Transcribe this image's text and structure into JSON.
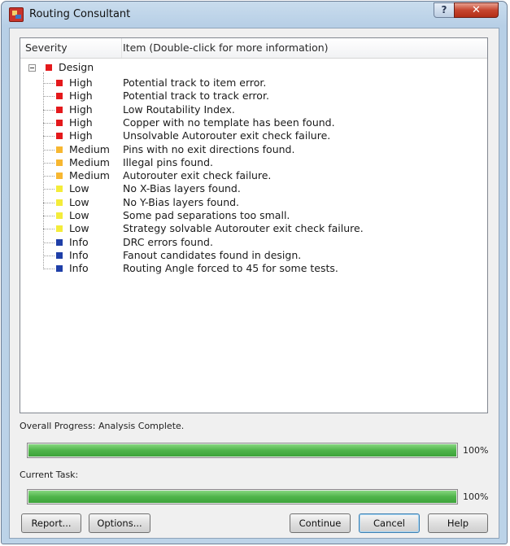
{
  "window": {
    "title": "Routing Consultant",
    "help_glyph": "?",
    "close_glyph": "✕"
  },
  "list": {
    "columns": [
      "Severity",
      "Item (Double-click for more information)"
    ],
    "root_label": "Design",
    "rows": [
      {
        "severity": "High",
        "item": "Potential track to item error.",
        "color": "#e4191c"
      },
      {
        "severity": "High",
        "item": "Potential track to track error.",
        "color": "#e4191c"
      },
      {
        "severity": "High",
        "item": "Low Routability Index.",
        "color": "#e4191c"
      },
      {
        "severity": "High",
        "item": "Copper with no template has been found.",
        "color": "#e4191c"
      },
      {
        "severity": "High",
        "item": "Unsolvable Autorouter exit check failure.",
        "color": "#e4191c"
      },
      {
        "severity": "Medium",
        "item": "Pins with no exit directions found.",
        "color": "#f7b731"
      },
      {
        "severity": "Medium",
        "item": "Illegal pins found.",
        "color": "#f7b731"
      },
      {
        "severity": "Medium",
        "item": "Autorouter exit check failure.",
        "color": "#f7b731"
      },
      {
        "severity": "Low",
        "item": "No X-Bias layers found.",
        "color": "#f4ec3a"
      },
      {
        "severity": "Low",
        "item": "No Y-Bias layers found.",
        "color": "#f4ec3a"
      },
      {
        "severity": "Low",
        "item": "Some pad separations too small.",
        "color": "#f4ec3a"
      },
      {
        "severity": "Low",
        "item": "Strategy solvable Autorouter exit check failure.",
        "color": "#f4ec3a"
      },
      {
        "severity": "Info",
        "item": "DRC errors found.",
        "color": "#1f3fa8"
      },
      {
        "severity": "Info",
        "item": "Fanout candidates found in design.",
        "color": "#1f3fa8"
      },
      {
        "severity": "Info",
        "item": "Routing Angle forced to 45 for some tests.",
        "color": "#1f3fa8"
      }
    ]
  },
  "progress": {
    "overall_label": "Overall Progress: Analysis Complete.",
    "overall_value": 100,
    "overall_text": "100%",
    "task_label": "Current Task:",
    "task_value": 100,
    "task_text": "100%"
  },
  "buttons": {
    "report": "Report...",
    "options": "Options...",
    "continue": "Continue",
    "cancel": "Cancel",
    "help": "Help"
  },
  "colors": {
    "high": "#e4191c",
    "medium": "#f7b731",
    "low": "#f4ec3a",
    "info": "#1f3fa8"
  }
}
